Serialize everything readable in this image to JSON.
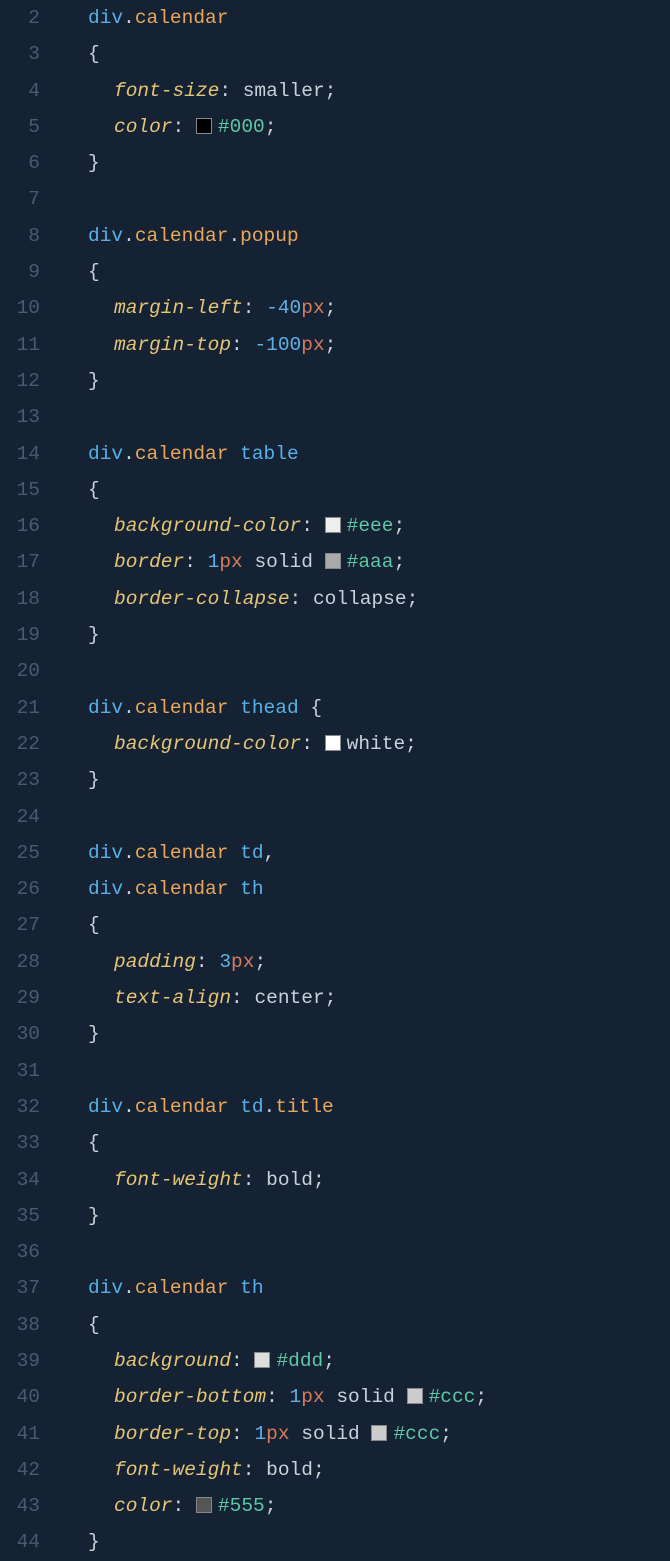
{
  "lines": [
    {
      "n": "2",
      "indent": 1,
      "tokens": [
        {
          "t": "div",
          "c": "tag"
        },
        {
          "t": ".",
          "c": "punct"
        },
        {
          "t": "calendar",
          "c": "cls"
        }
      ]
    },
    {
      "n": "3",
      "indent": 1,
      "tokens": [
        {
          "t": "{",
          "c": "punct"
        }
      ]
    },
    {
      "n": "4",
      "indent": 2,
      "tokens": [
        {
          "t": "font-size",
          "c": "prop"
        },
        {
          "t": ": ",
          "c": "punct"
        },
        {
          "t": "smaller",
          "c": "val"
        },
        {
          "t": ";",
          "c": "punct"
        }
      ]
    },
    {
      "n": "5",
      "indent": 2,
      "tokens": [
        {
          "t": "color",
          "c": "prop"
        },
        {
          "t": ": ",
          "c": "punct"
        },
        {
          "swatch": "#000000"
        },
        {
          "t": "#000",
          "c": "hex"
        },
        {
          "t": ";",
          "c": "punct"
        }
      ]
    },
    {
      "n": "6",
      "indent": 1,
      "tokens": [
        {
          "t": "}",
          "c": "punct"
        }
      ]
    },
    {
      "n": "7",
      "indent": 0,
      "tokens": []
    },
    {
      "n": "8",
      "indent": 1,
      "tokens": [
        {
          "t": "div",
          "c": "tag"
        },
        {
          "t": ".",
          "c": "punct"
        },
        {
          "t": "calendar",
          "c": "cls"
        },
        {
          "t": ".",
          "c": "punct"
        },
        {
          "t": "popup",
          "c": "cls"
        }
      ]
    },
    {
      "n": "9",
      "indent": 1,
      "tokens": [
        {
          "t": "{",
          "c": "punct"
        }
      ]
    },
    {
      "n": "10",
      "indent": 2,
      "tokens": [
        {
          "t": "margin-left",
          "c": "prop"
        },
        {
          "t": ": ",
          "c": "punct"
        },
        {
          "t": "-40",
          "c": "num"
        },
        {
          "t": "px",
          "c": "unit"
        },
        {
          "t": ";",
          "c": "punct"
        }
      ]
    },
    {
      "n": "11",
      "indent": 2,
      "tokens": [
        {
          "t": "margin-top",
          "c": "prop"
        },
        {
          "t": ": ",
          "c": "punct"
        },
        {
          "t": "-100",
          "c": "num"
        },
        {
          "t": "px",
          "c": "unit"
        },
        {
          "t": ";",
          "c": "punct"
        }
      ]
    },
    {
      "n": "12",
      "indent": 1,
      "tokens": [
        {
          "t": "}",
          "c": "punct"
        }
      ]
    },
    {
      "n": "13",
      "indent": 0,
      "tokens": []
    },
    {
      "n": "14",
      "indent": 1,
      "tokens": [
        {
          "t": "div",
          "c": "tag"
        },
        {
          "t": ".",
          "c": "punct"
        },
        {
          "t": "calendar",
          "c": "cls"
        },
        {
          "t": " ",
          "c": "punct"
        },
        {
          "t": "table",
          "c": "tag"
        }
      ]
    },
    {
      "n": "15",
      "indent": 1,
      "tokens": [
        {
          "t": "{",
          "c": "punct"
        }
      ]
    },
    {
      "n": "16",
      "indent": 2,
      "tokens": [
        {
          "t": "background-color",
          "c": "prop"
        },
        {
          "t": ": ",
          "c": "punct"
        },
        {
          "swatch": "#eeeeee"
        },
        {
          "t": "#eee",
          "c": "hex"
        },
        {
          "t": ";",
          "c": "punct"
        }
      ]
    },
    {
      "n": "17",
      "indent": 2,
      "tokens": [
        {
          "t": "border",
          "c": "prop"
        },
        {
          "t": ": ",
          "c": "punct"
        },
        {
          "t": "1",
          "c": "num"
        },
        {
          "t": "px",
          "c": "unit"
        },
        {
          "t": " ",
          "c": "punct"
        },
        {
          "t": "solid",
          "c": "val"
        },
        {
          "t": " ",
          "c": "punct"
        },
        {
          "swatch": "#aaaaaa"
        },
        {
          "t": "#aaa",
          "c": "hex"
        },
        {
          "t": ";",
          "c": "punct"
        }
      ]
    },
    {
      "n": "18",
      "indent": 2,
      "tokens": [
        {
          "t": "border-collapse",
          "c": "prop"
        },
        {
          "t": ": ",
          "c": "punct"
        },
        {
          "t": "collapse",
          "c": "val"
        },
        {
          "t": ";",
          "c": "punct"
        }
      ]
    },
    {
      "n": "19",
      "indent": 1,
      "tokens": [
        {
          "t": "}",
          "c": "punct"
        }
      ]
    },
    {
      "n": "20",
      "indent": 0,
      "tokens": []
    },
    {
      "n": "21",
      "indent": 1,
      "tokens": [
        {
          "t": "div",
          "c": "tag"
        },
        {
          "t": ".",
          "c": "punct"
        },
        {
          "t": "calendar",
          "c": "cls"
        },
        {
          "t": " ",
          "c": "punct"
        },
        {
          "t": "thead",
          "c": "tag"
        },
        {
          "t": " {",
          "c": "punct"
        }
      ]
    },
    {
      "n": "22",
      "indent": 2,
      "tokens": [
        {
          "t": "background-color",
          "c": "prop"
        },
        {
          "t": ": ",
          "c": "punct"
        },
        {
          "swatch": "#ffffff"
        },
        {
          "t": "white",
          "c": "named"
        },
        {
          "t": ";",
          "c": "punct"
        }
      ]
    },
    {
      "n": "23",
      "indent": 1,
      "tokens": [
        {
          "t": "}",
          "c": "punct"
        }
      ]
    },
    {
      "n": "24",
      "indent": 0,
      "tokens": []
    },
    {
      "n": "25",
      "indent": 1,
      "tokens": [
        {
          "t": "div",
          "c": "tag"
        },
        {
          "t": ".",
          "c": "punct"
        },
        {
          "t": "calendar",
          "c": "cls"
        },
        {
          "t": " ",
          "c": "punct"
        },
        {
          "t": "td",
          "c": "tag"
        },
        {
          "t": ",",
          "c": "punct"
        }
      ]
    },
    {
      "n": "26",
      "indent": 1,
      "tokens": [
        {
          "t": "div",
          "c": "tag"
        },
        {
          "t": ".",
          "c": "punct"
        },
        {
          "t": "calendar",
          "c": "cls"
        },
        {
          "t": " ",
          "c": "punct"
        },
        {
          "t": "th",
          "c": "tag"
        }
      ]
    },
    {
      "n": "27",
      "indent": 1,
      "tokens": [
        {
          "t": "{",
          "c": "punct"
        }
      ]
    },
    {
      "n": "28",
      "indent": 2,
      "tokens": [
        {
          "t": "padding",
          "c": "prop"
        },
        {
          "t": ": ",
          "c": "punct"
        },
        {
          "t": "3",
          "c": "num"
        },
        {
          "t": "px",
          "c": "unit"
        },
        {
          "t": ";",
          "c": "punct"
        }
      ]
    },
    {
      "n": "29",
      "indent": 2,
      "tokens": [
        {
          "t": "text-align",
          "c": "prop"
        },
        {
          "t": ": ",
          "c": "punct"
        },
        {
          "t": "center",
          "c": "val"
        },
        {
          "t": ";",
          "c": "punct"
        }
      ]
    },
    {
      "n": "30",
      "indent": 1,
      "tokens": [
        {
          "t": "}",
          "c": "punct"
        }
      ]
    },
    {
      "n": "31",
      "indent": 0,
      "tokens": []
    },
    {
      "n": "32",
      "indent": 1,
      "tokens": [
        {
          "t": "div",
          "c": "tag"
        },
        {
          "t": ".",
          "c": "punct"
        },
        {
          "t": "calendar",
          "c": "cls"
        },
        {
          "t": " ",
          "c": "punct"
        },
        {
          "t": "td",
          "c": "tag"
        },
        {
          "t": ".",
          "c": "punct"
        },
        {
          "t": "title",
          "c": "cls"
        }
      ]
    },
    {
      "n": "33",
      "indent": 1,
      "tokens": [
        {
          "t": "{",
          "c": "punct"
        }
      ]
    },
    {
      "n": "34",
      "indent": 2,
      "tokens": [
        {
          "t": "font-weight",
          "c": "prop"
        },
        {
          "t": ": ",
          "c": "punct"
        },
        {
          "t": "bold",
          "c": "val"
        },
        {
          "t": ";",
          "c": "punct"
        }
      ]
    },
    {
      "n": "35",
      "indent": 1,
      "tokens": [
        {
          "t": "}",
          "c": "punct"
        }
      ]
    },
    {
      "n": "36",
      "indent": 0,
      "tokens": []
    },
    {
      "n": "37",
      "indent": 1,
      "tokens": [
        {
          "t": "div",
          "c": "tag"
        },
        {
          "t": ".",
          "c": "punct"
        },
        {
          "t": "calendar",
          "c": "cls"
        },
        {
          "t": " ",
          "c": "punct"
        },
        {
          "t": "th",
          "c": "tag"
        }
      ]
    },
    {
      "n": "38",
      "indent": 1,
      "tokens": [
        {
          "t": "{",
          "c": "punct"
        }
      ]
    },
    {
      "n": "39",
      "indent": 2,
      "tokens": [
        {
          "t": "background",
          "c": "prop"
        },
        {
          "t": ": ",
          "c": "punct"
        },
        {
          "swatch": "#dddddd"
        },
        {
          "t": "#ddd",
          "c": "hex"
        },
        {
          "t": ";",
          "c": "punct"
        }
      ]
    },
    {
      "n": "40",
      "indent": 2,
      "tokens": [
        {
          "t": "border-bottom",
          "c": "prop"
        },
        {
          "t": ": ",
          "c": "punct"
        },
        {
          "t": "1",
          "c": "num"
        },
        {
          "t": "px",
          "c": "unit"
        },
        {
          "t": " ",
          "c": "punct"
        },
        {
          "t": "solid",
          "c": "val"
        },
        {
          "t": " ",
          "c": "punct"
        },
        {
          "swatch": "#cccccc"
        },
        {
          "t": "#ccc",
          "c": "hex"
        },
        {
          "t": ";",
          "c": "punct"
        }
      ]
    },
    {
      "n": "41",
      "indent": 2,
      "tokens": [
        {
          "t": "border-top",
          "c": "prop"
        },
        {
          "t": ": ",
          "c": "punct"
        },
        {
          "t": "1",
          "c": "num"
        },
        {
          "t": "px",
          "c": "unit"
        },
        {
          "t": " ",
          "c": "punct"
        },
        {
          "t": "solid",
          "c": "val"
        },
        {
          "t": " ",
          "c": "punct"
        },
        {
          "swatch": "#cccccc"
        },
        {
          "t": "#ccc",
          "c": "hex"
        },
        {
          "t": ";",
          "c": "punct"
        }
      ]
    },
    {
      "n": "42",
      "indent": 2,
      "tokens": [
        {
          "t": "font-weight",
          "c": "prop"
        },
        {
          "t": ": ",
          "c": "punct"
        },
        {
          "t": "bold",
          "c": "val"
        },
        {
          "t": ";",
          "c": "punct"
        }
      ]
    },
    {
      "n": "43",
      "indent": 2,
      "tokens": [
        {
          "t": "color",
          "c": "prop"
        },
        {
          "t": ": ",
          "c": "punct"
        },
        {
          "swatch": "#555555"
        },
        {
          "t": "#555",
          "c": "hex"
        },
        {
          "t": ";",
          "c": "punct"
        }
      ]
    },
    {
      "n": "44",
      "indent": 1,
      "tokens": [
        {
          "t": "}",
          "c": "punct"
        }
      ]
    }
  ]
}
